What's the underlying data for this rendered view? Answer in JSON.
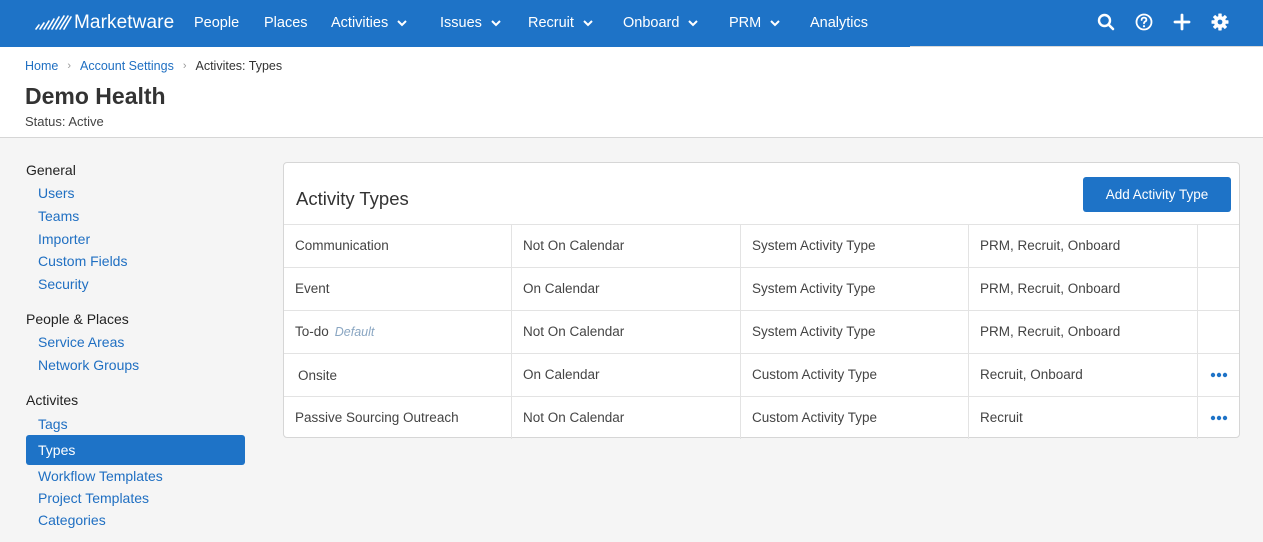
{
  "app": {
    "name": "Marketware"
  },
  "nav": {
    "items": [
      {
        "label": "People",
        "dropdown": false
      },
      {
        "label": "Places",
        "dropdown": false
      },
      {
        "label": "Activities",
        "dropdown": true
      },
      {
        "label": "Issues",
        "dropdown": true
      },
      {
        "label": "Recruit",
        "dropdown": true
      },
      {
        "label": "Onboard",
        "dropdown": true
      },
      {
        "label": "PRM",
        "dropdown": true
      },
      {
        "label": "Analytics",
        "dropdown": false
      }
    ],
    "tools": [
      "search-icon",
      "help-icon",
      "add-icon",
      "settings-icon"
    ]
  },
  "breadcrumb": {
    "home": "Home",
    "account_settings": "Account Settings",
    "current": "Activites: Types"
  },
  "header": {
    "title": "Demo Health",
    "status": "Status: Active"
  },
  "sidebar": {
    "groups": [
      {
        "label": "General",
        "items": [
          "Users",
          "Teams",
          "Importer",
          "Custom Fields",
          "Security"
        ]
      },
      {
        "label": "People & Places",
        "items": [
          "Service Areas",
          "Network Groups"
        ]
      },
      {
        "label": "Activites",
        "items": [
          "Tags",
          "Types",
          "Workflow Templates",
          "Project Templates",
          "Categories"
        ]
      }
    ],
    "active_item": "Types"
  },
  "card": {
    "title": "Activity Types",
    "add_button": "Add Activity Type",
    "rows": [
      {
        "name": "Communication",
        "default": "",
        "calendar": "Not On Calendar",
        "kind": "System Activity Type",
        "modules": "PRM, Recruit, Onboard",
        "has_menu": false
      },
      {
        "name": "Event",
        "default": "",
        "calendar": "On Calendar",
        "kind": "System Activity Type",
        "modules": "PRM, Recruit, Onboard",
        "has_menu": false
      },
      {
        "name": "To-do",
        "default": "Default",
        "calendar": "Not On Calendar",
        "kind": "System Activity Type",
        "modules": "PRM, Recruit, Onboard",
        "has_menu": false
      },
      {
        "name": "Onsite",
        "default": "",
        "calendar": "On Calendar",
        "kind": "Custom Activity Type",
        "modules": "Recruit, Onboard",
        "has_menu": true
      },
      {
        "name": "Passive Sourcing Outreach",
        "default": "",
        "calendar": "Not On Calendar",
        "kind": "Custom Activity Type",
        "modules": "Recruit",
        "has_menu": true
      }
    ]
  },
  "colors": {
    "brand": "#1e73c7",
    "link": "#1f6fc2",
    "default_tag": "#8aa6c2"
  }
}
